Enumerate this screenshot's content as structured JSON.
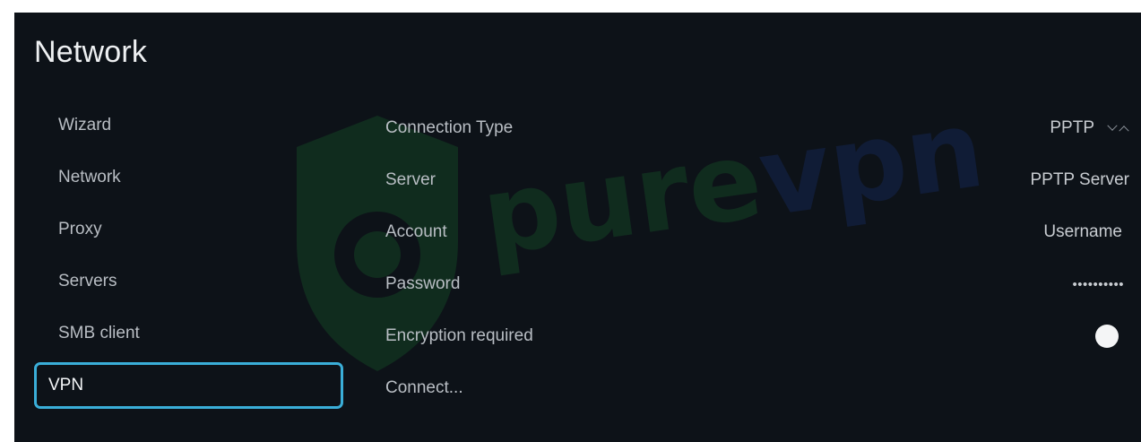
{
  "header": {
    "title": "Network"
  },
  "watermark": {
    "brand_text": "purevpn",
    "pure_color": "#1c8a37",
    "vpn_color": "#1d3fa3"
  },
  "sidebar": {
    "items": [
      {
        "label": "Wizard",
        "active": false
      },
      {
        "label": "Network",
        "active": false
      },
      {
        "label": "Proxy",
        "active": false
      },
      {
        "label": "Servers",
        "active": false
      },
      {
        "label": "SMB client",
        "active": false
      },
      {
        "label": "VPN",
        "active": true
      }
    ],
    "active_border_color": "#3aaed8"
  },
  "settings": {
    "connection_type": {
      "label": "Connection Type",
      "value": "PPTP",
      "control": "arrow-stepper"
    },
    "server": {
      "label": "Server",
      "value": "PPTP Server"
    },
    "account": {
      "label": "Account",
      "value": "Username"
    },
    "password": {
      "label": "Password",
      "value": "••••••••••"
    },
    "encryption": {
      "label": "Encryption required",
      "control": "toggle",
      "knob_color": "#f4f5f6"
    },
    "connect": {
      "label": "Connect..."
    }
  },
  "colors": {
    "background": "#0d1218",
    "text_primary": "#eef0f2",
    "text_secondary": "#b9bec4"
  }
}
